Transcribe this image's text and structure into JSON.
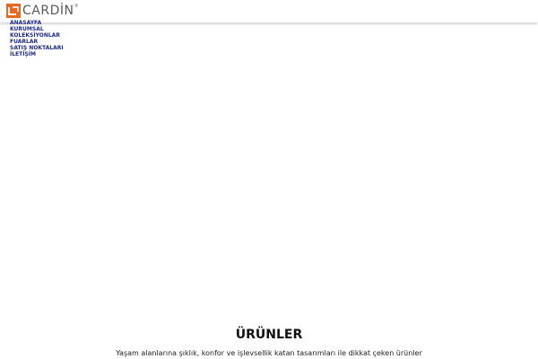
{
  "brand": {
    "name": "CARDİN",
    "registered_mark": "®",
    "logo_icon": "cardin-logo-icon",
    "accent_color": "#e8681f",
    "text_color": "#5a5a5a"
  },
  "nav": {
    "link_color": "#1c2a8c",
    "items": [
      {
        "label": "ANASAYFA"
      },
      {
        "label": "KURUMSAL"
      },
      {
        "label": "KOLEKSİYONLAR"
      },
      {
        "label": "FUARLAR"
      },
      {
        "label": "SATIŞ NOKTALARI"
      },
      {
        "label": "İLETİŞİM"
      }
    ]
  },
  "products_section": {
    "title": "ÜRÜNLER",
    "subtitle": "Yaşam alanlarına şıklık, konfor ve işlevsellik katan tasarımları ile dikkat çeken ürünler"
  }
}
